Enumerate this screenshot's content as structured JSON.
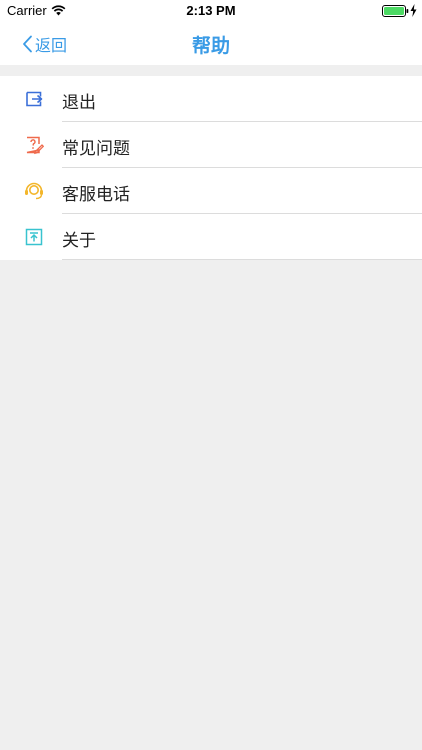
{
  "status_bar": {
    "carrier": "Carrier",
    "time": "2:13 PM"
  },
  "nav": {
    "back_label": "返回",
    "title": "帮助"
  },
  "menu": {
    "items": [
      {
        "label": "退出",
        "icon": "logout-icon",
        "color": "#3b6fd8"
      },
      {
        "label": "常见问题",
        "icon": "faq-icon",
        "color": "#ef6a4c"
      },
      {
        "label": "客服电话",
        "icon": "headset-icon",
        "color": "#f3b62b"
      },
      {
        "label": "关于",
        "icon": "about-icon",
        "color": "#39c3cf"
      }
    ]
  },
  "colors": {
    "accent": "#3a9be6",
    "background": "#efefef"
  }
}
